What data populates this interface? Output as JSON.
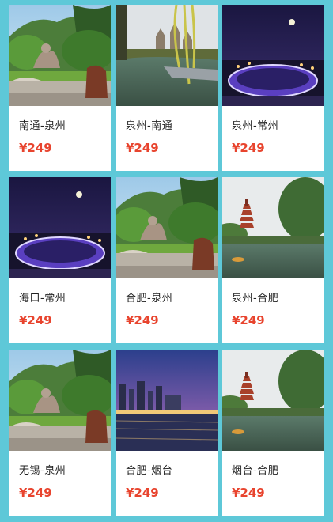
{
  "accent_price_color": "#e8442e",
  "background_color": "#5ec8d8",
  "cards": [
    {
      "route": "南通-泉州",
      "price": "¥249",
      "image": "buddha-statue-hillside"
    },
    {
      "route": "泉州-南通",
      "price": "¥249",
      "image": "castle-by-lake"
    },
    {
      "route": "泉州-常州",
      "price": "¥249",
      "image": "stadium-night"
    },
    {
      "route": "海口-常州",
      "price": "¥249",
      "image": "stadium-night"
    },
    {
      "route": "合肥-泉州",
      "price": "¥249",
      "image": "buddha-statue-hillside"
    },
    {
      "route": "泉州-合肥",
      "price": "¥249",
      "image": "pagoda-lake"
    },
    {
      "route": "无锡-泉州",
      "price": "¥249",
      "image": "buddha-statue-hillside"
    },
    {
      "route": "合肥-烟台",
      "price": "¥249",
      "image": "city-skyline-dusk"
    },
    {
      "route": "烟台-合肥",
      "price": "¥249",
      "image": "pagoda-lake"
    }
  ]
}
